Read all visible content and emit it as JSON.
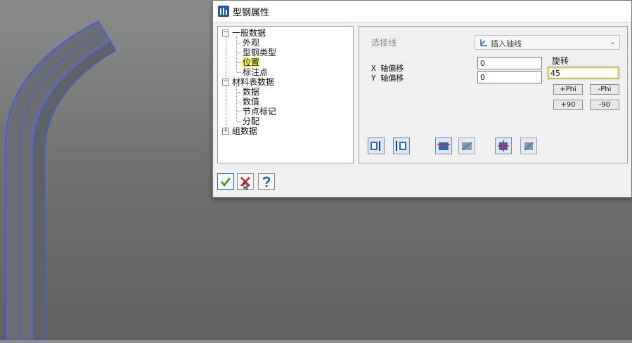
{
  "dialog": {
    "title": "型钢属性"
  },
  "tree": {
    "groups": [
      {
        "label": "一般数据",
        "expander": "−",
        "children": [
          "外观",
          "型钢类型",
          "位置",
          "标注点"
        ]
      },
      {
        "label": "材料表数据",
        "expander": "−",
        "children": [
          "数据",
          "数值",
          "节点标记",
          "分配"
        ]
      },
      {
        "label": "组数据",
        "expander": "+",
        "children": []
      }
    ],
    "selected": "位置"
  },
  "props": {
    "select_line_label": "选择线",
    "select_line_value": "插入轴线",
    "x_offset_label": "X 轴偏移",
    "x_offset_value": "0",
    "y_offset_label": "Y 轴偏移",
    "y_offset_value": "0",
    "rotation_label": "旋转",
    "rotation_value": "45",
    "plus_phi": "+Phi",
    "minus_phi": "-Phi",
    "plus_90": "+90",
    "minus_90": "-90"
  },
  "colors": {
    "highlight": "#f4f27a",
    "accent": "#1d5aa6",
    "ok_green": "#2aa02a",
    "cancel_red": "#d02020"
  },
  "icons": [
    "app-icon",
    "axis-line-icon",
    "chevron-down-icon",
    "ok-check-icon",
    "cancel-icon",
    "help-icon"
  ]
}
